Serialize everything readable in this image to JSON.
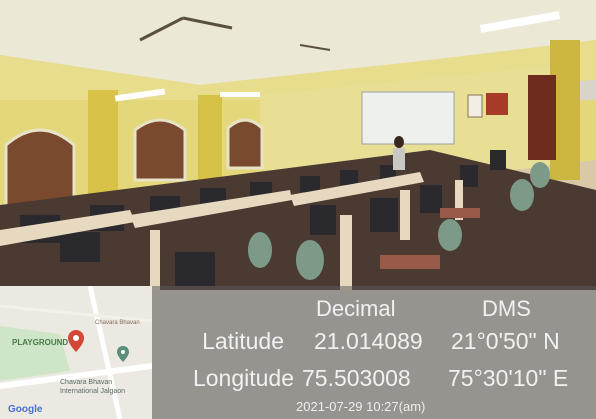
{
  "geotag": {
    "headers": {
      "decimal": "Decimal",
      "dms": "DMS"
    },
    "rows": [
      {
        "label": "Latitude",
        "decimal": "21.014089",
        "dms": "21°0'50\" N"
      },
      {
        "label": "Longitude",
        "decimal": "75.503008",
        "dms": "75°30'10\" E"
      }
    ],
    "timestamp": "2021-07-29  10:27(am)"
  },
  "map": {
    "attribution": "Google",
    "places": [
      "PLAYGROUND",
      "Chavara Bhavan",
      "Chavara Bhavan International Jalgaon"
    ]
  },
  "colors": {
    "wall": "#e3d77a",
    "pillar": "#d8c348",
    "floor": "#d9c9a6",
    "overlay": "#5a5a5a"
  }
}
